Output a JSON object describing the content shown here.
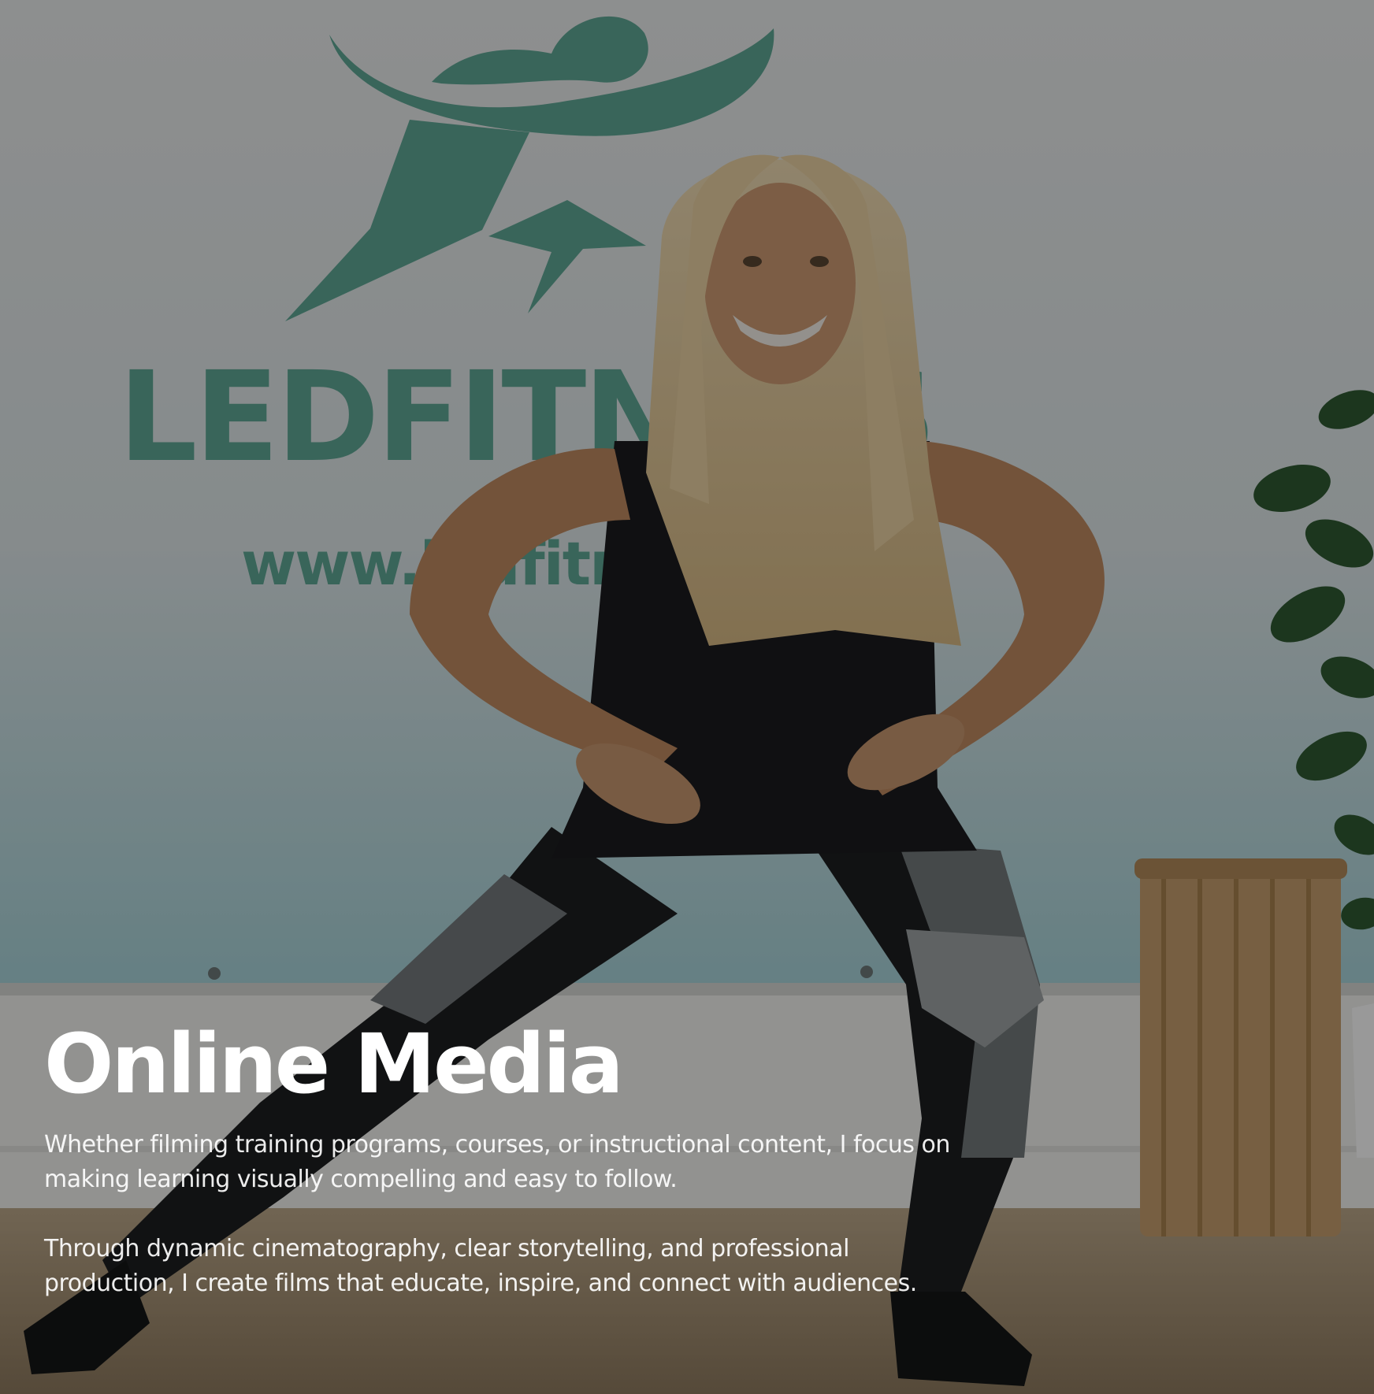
{
  "banner": {
    "brand_text": "LEDFITNESS",
    "url_text": "www.ledfitness"
  },
  "hero": {
    "title": "Online Media",
    "paragraph_1": "Whether filming training programs, courses, or instructional content, I focus on making learning visually compelling and easy to follow.",
    "paragraph_2": "Through dynamic cinematography, clear storytelling, and professional production, I create films that educate, inspire, and connect with audiences."
  },
  "colors": {
    "banner_green": "#5fa896",
    "banner_bg_top": "#e9ecec",
    "banner_bg_bottom": "#a9d6dc",
    "overlay": "rgba(0,0,0,0.40)",
    "text": "#ffffff"
  }
}
